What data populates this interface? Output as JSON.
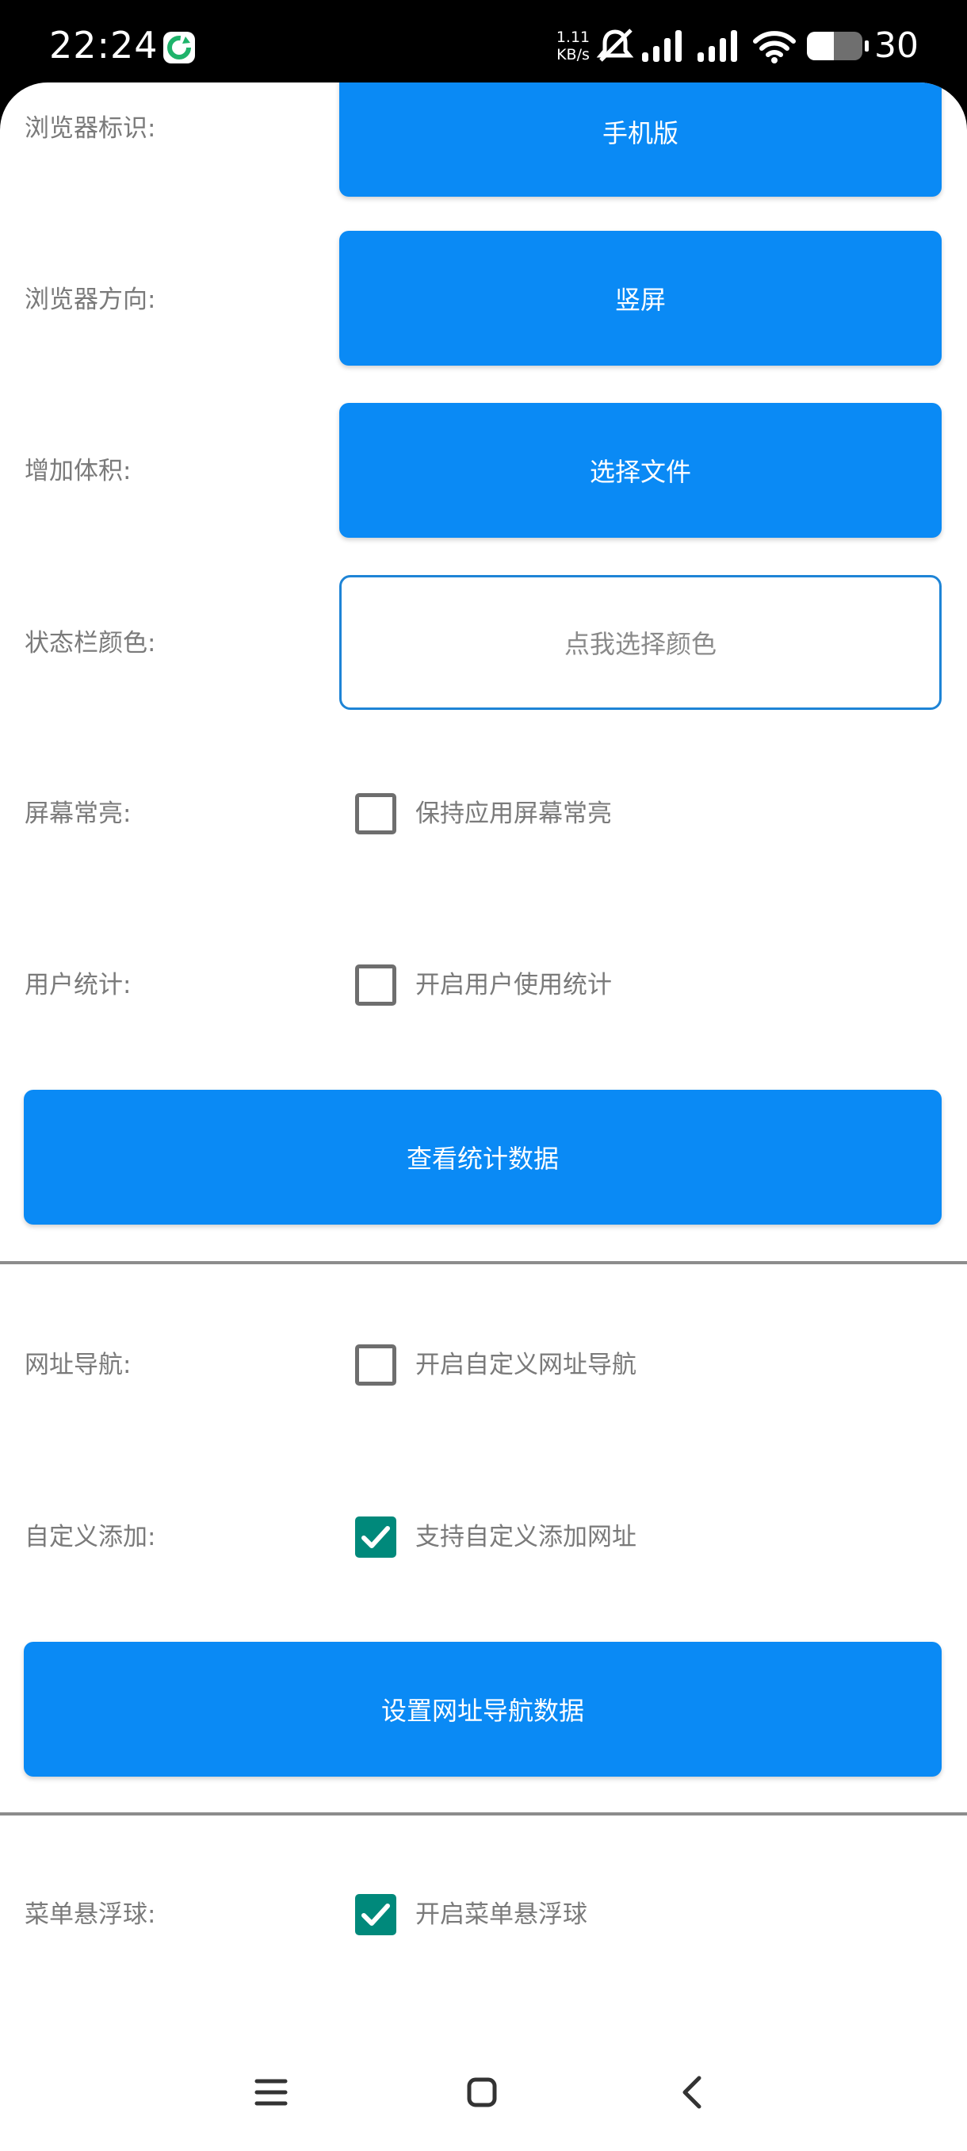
{
  "status_bar": {
    "time": "22:24",
    "net_speed_value": "1.11",
    "net_speed_unit": "KB/s",
    "battery_level": "30",
    "icons": [
      "app-notification-icon",
      "mute-icon",
      "signal-icon",
      "signal-icon",
      "wifi-icon",
      "battery-icon"
    ]
  },
  "settings": {
    "browser_id": {
      "label": "浏览器标识:",
      "value": "手机版"
    },
    "orientation": {
      "label": "浏览器方向:",
      "value": "竖屏"
    },
    "increase_size": {
      "label": "增加体积:",
      "value": "选择文件"
    },
    "status_bar_color": {
      "label": "状态栏颜色:",
      "value": "点我选择颜色"
    },
    "screen_on": {
      "label": "屏幕常亮:",
      "checkbox_label": "保持应用屏幕常亮",
      "checked": false
    },
    "user_stats": {
      "label": "用户统计:",
      "checkbox_label": "开启用户使用统计",
      "checked": false
    },
    "view_stats_button": "查看统计数据",
    "url_nav": {
      "label": "网址导航:",
      "checkbox_label": "开启自定义网址导航",
      "checked": false
    },
    "custom_add": {
      "label": "自定义添加:",
      "checkbox_label": "支持自定义添加网址",
      "checked": true
    },
    "set_nav_button": "设置网址导航数据",
    "float_menu": {
      "label": "菜单悬浮球:",
      "checkbox_label": "开启菜单悬浮球",
      "checked": true
    }
  },
  "colors": {
    "primary_button": "#0a8af5",
    "outline_border": "#1e84d6",
    "checkbox_checked": "#00897b",
    "label_text": "#7a7a7a"
  },
  "nav_bar": {
    "icons": [
      "menu-icon",
      "home-icon",
      "back-icon"
    ]
  }
}
